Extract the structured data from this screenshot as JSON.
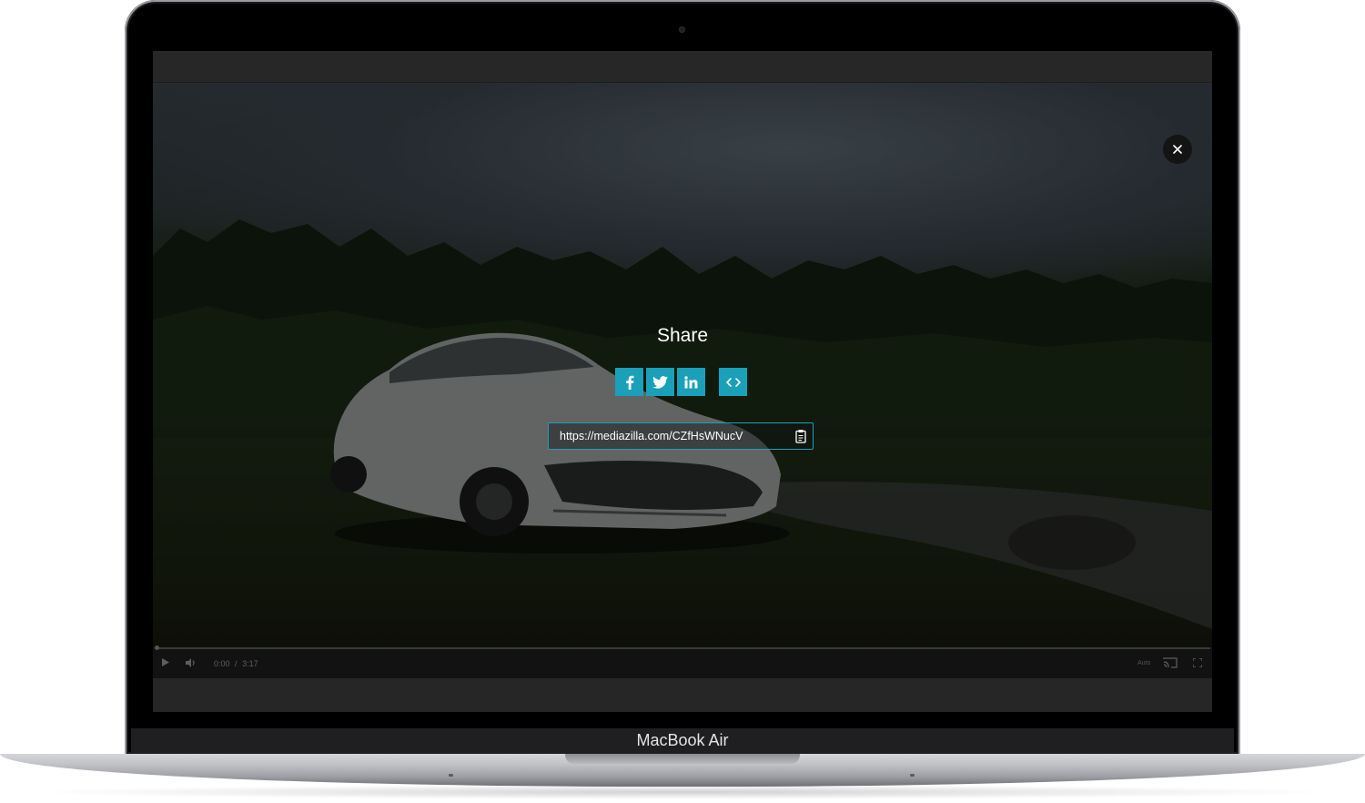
{
  "device": {
    "label": "MacBook Air"
  },
  "player": {
    "share": {
      "title": "Share",
      "buttons": [
        {
          "name": "facebook",
          "icon": "facebook-icon"
        },
        {
          "name": "twitter",
          "icon": "twitter-icon"
        },
        {
          "name": "linkedin",
          "icon": "linkedin-icon"
        },
        {
          "name": "embed",
          "icon": "code-icon"
        }
      ],
      "url": "https://mediazilla.com/CZfHsWNucV",
      "copy_icon": "clipboard-icon"
    },
    "close_icon": "close-icon",
    "controls": {
      "current_time": "0:00",
      "separator": "/",
      "duration": "3:17",
      "quality": "Auto",
      "progress": 0
    },
    "colors": {
      "accent": "#1aa0b8",
      "backdrop": "#262626"
    }
  }
}
